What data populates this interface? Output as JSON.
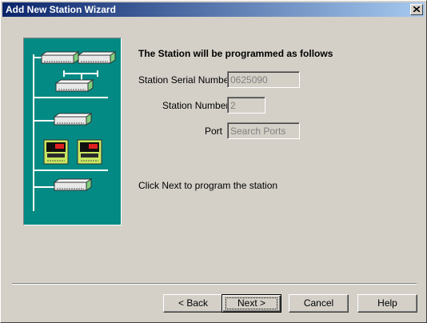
{
  "window": {
    "title": "Add New Station Wizard",
    "close_icon": "close-icon"
  },
  "art": {
    "icon": "station-network-illustration",
    "background": "#048a84"
  },
  "content": {
    "heading": "The Station will be programmed as follows",
    "serial_label": "Station Serial Number",
    "serial_value": "0625090",
    "station_label": "Station Number",
    "station_value": "2",
    "port_label": "Port",
    "port_value": "Search Ports",
    "hint": "Click Next to program the station"
  },
  "buttons": {
    "back_label": "< Back",
    "next_label": "Next >",
    "cancel_label": "Cancel",
    "help_label": "Help"
  }
}
